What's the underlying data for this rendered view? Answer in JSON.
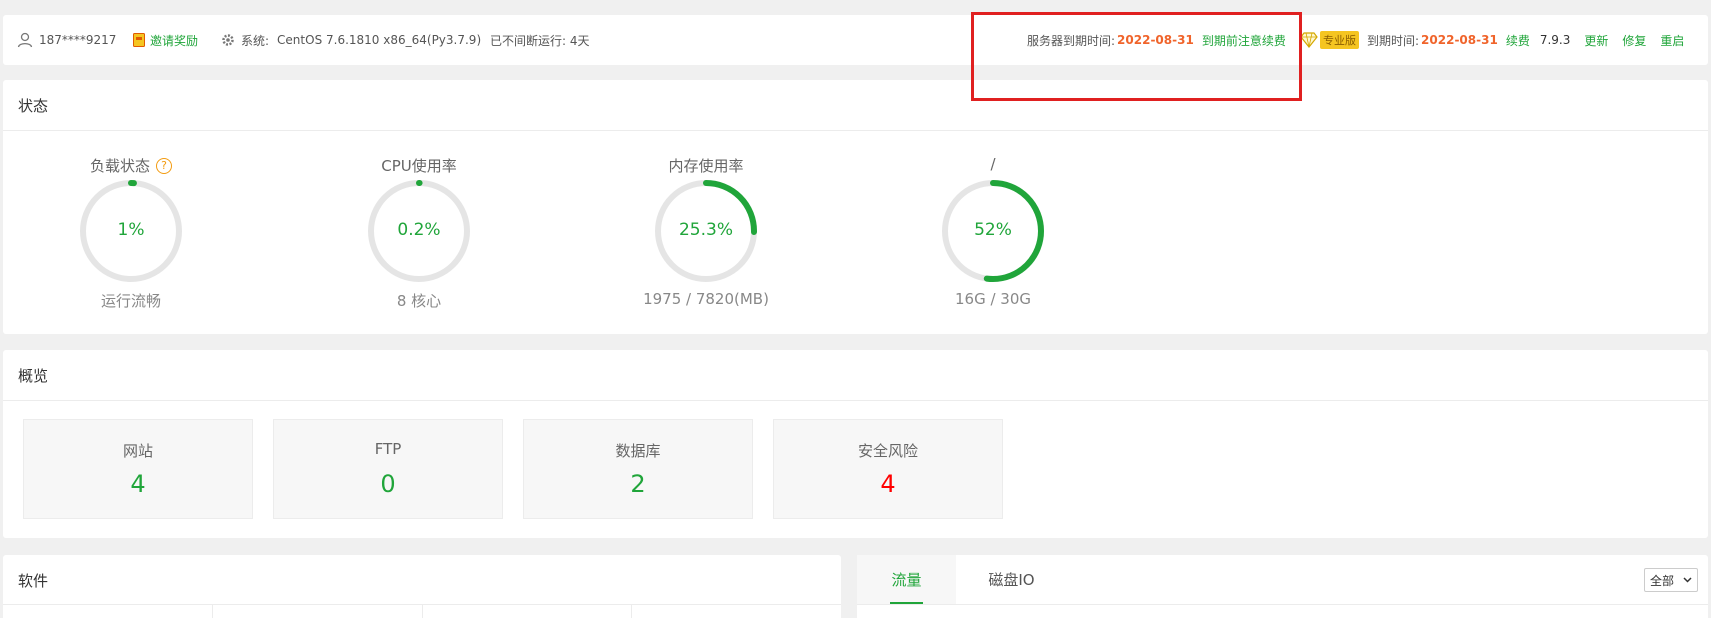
{
  "header": {
    "user": "187****9217",
    "invite": "邀请奖励",
    "system_label": "系统:",
    "system_value": "CentOS 7.6.1810 x86_64(Py3.7.9)",
    "uptime": "已不间断运行: 4天",
    "server_expire_label": "服务器到期时间:",
    "server_expire_date": "2022-08-31",
    "server_expire_notice": "到期前注意续费",
    "pro_badge": "专业版",
    "expire_label": "到期时间:",
    "expire_date": "2022-08-31",
    "renew": "续费",
    "version": "7.9.3",
    "update": "更新",
    "repair": "修复",
    "restart": "重启"
  },
  "status": {
    "title": "状态",
    "gauges": [
      {
        "label": "负载状态",
        "value": "1%",
        "fraction": 0.01,
        "sub": "运行流畅"
      },
      {
        "label": "CPU使用率",
        "value": "0.2%",
        "fraction": 0.002,
        "sub": "8 核心"
      },
      {
        "label": "内存使用率",
        "value": "25.3%",
        "fraction": 0.253,
        "sub": "1975 / 7820(MB)"
      },
      {
        "label": "/",
        "value": "52%",
        "fraction": 0.52,
        "sub": "16G / 30G"
      }
    ]
  },
  "overview": {
    "title": "概览",
    "cards": [
      {
        "label": "网站",
        "value": "4"
      },
      {
        "label": "FTP",
        "value": "0"
      },
      {
        "label": "数据库",
        "value": "2"
      },
      {
        "label": "安全风险",
        "value": "4"
      }
    ]
  },
  "software": {
    "title": "软件"
  },
  "traffic": {
    "tabs": [
      "流量",
      "磁盘IO"
    ],
    "select_value": "全部"
  },
  "colors": {
    "accent": "#20a53a",
    "warning": "#f0642b",
    "danger": "#ff0000",
    "track": "#e5e5e5"
  }
}
